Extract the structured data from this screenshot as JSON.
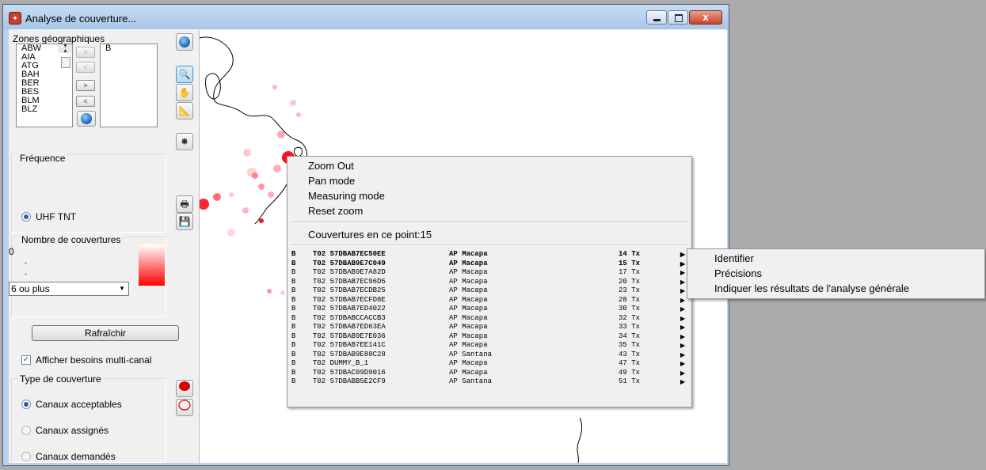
{
  "window": {
    "title": "Analyse de couverture...",
    "close_glyph": "x"
  },
  "zones": {
    "label": "Zones géographiques",
    "available": [
      "ABW",
      "AIA",
      "ATG",
      "BAH",
      "BER",
      "BES",
      "BLM",
      "BLZ"
    ],
    "selected": [
      "B"
    ],
    "btn_add_one": ">",
    "btn_remove_one": "<",
    "btn_add": ">",
    "btn_remove": "<"
  },
  "frequency": {
    "label": "Fréquence",
    "option": "UHF TNT"
  },
  "coverage_count": {
    "label": "Nombre de couvertures",
    "min_value": "0",
    "mid_tick_1": "-",
    "mid_tick_2": "-",
    "selected": "6 ou plus"
  },
  "refresh_label": "Rafraîchir",
  "multi_channel": {
    "label": "Afficher besoins multi-canal",
    "checked": true
  },
  "coverage_type": {
    "label": "Type de couverture",
    "options": [
      "Canaux acceptables",
      "Canaux assignés",
      "Canaux demandés"
    ],
    "selected_index": 0
  },
  "context_menu": {
    "items": [
      "Zoom Out",
      "Pan mode",
      "Measuring mode",
      "Reset zoom"
    ],
    "header": "Couvertures en ce point:15",
    "rows": [
      {
        "zone": "B",
        "id": "T02 57DBAB7EC50EE",
        "site": "AP Macapa",
        "tx": "14 Tx"
      },
      {
        "zone": "B",
        "id": "T02 57DBAB9E7C049",
        "site": "AP Macapa",
        "tx": "15 Tx"
      },
      {
        "zone": "B",
        "id": "T02 57DBAB9E7A82D",
        "site": "AP Macapa",
        "tx": "17 Tx"
      },
      {
        "zone": "B",
        "id": "T02 57DBAB7EC96D5",
        "site": "AP Macapa",
        "tx": "20 Tx"
      },
      {
        "zone": "B",
        "id": "T02 57DBAB7ECDB25",
        "site": "AP Macapa",
        "tx": "23 Tx"
      },
      {
        "zone": "B",
        "id": "T02 57DBAB7ECFD8E",
        "site": "AP Macapa",
        "tx": "28 Tx"
      },
      {
        "zone": "B",
        "id": "T02 57DBAB7ED4022",
        "site": "AP Macapa",
        "tx": "30 Tx"
      },
      {
        "zone": "B",
        "id": "T02 57DBABCCACCB3",
        "site": "AP Macapa",
        "tx": "32 Tx"
      },
      {
        "zone": "B",
        "id": "T02 57DBAB7ED63EA",
        "site": "AP Macapa",
        "tx": "33 Tx"
      },
      {
        "zone": "B",
        "id": "T02 57DBAB9E7E036",
        "site": "AP Macapa",
        "tx": "34 Tx"
      },
      {
        "zone": "B",
        "id": "T02 57DBAB7EE141C",
        "site": "AP Macapa",
        "tx": "35 Tx"
      },
      {
        "zone": "B",
        "id": "T02 57DBAB9E88C28",
        "site": "AP Santana",
        "tx": "43 Tx"
      },
      {
        "zone": "B",
        "id": "T02 DUMMY_B_1",
        "site": "AP Macapa",
        "tx": "47 Tx"
      },
      {
        "zone": "B",
        "id": "T02 57DBAC09D9016",
        "site": "AP Macapa",
        "tx": "49 Tx"
      },
      {
        "zone": "B",
        "id": "T02 57DBABB5E2CF9",
        "site": "AP Santana",
        "tx": "51 Tx"
      }
    ]
  },
  "submenu": {
    "items": [
      "Identifier",
      "Précisions",
      "Indiquer les résultats de l'analyse générale"
    ]
  },
  "colors": {
    "coverage": "#ff0000",
    "title_bg": "#b9d1ea"
  }
}
